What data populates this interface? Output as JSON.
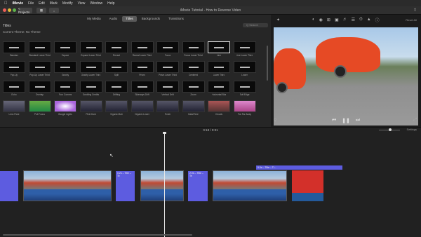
{
  "menubar": {
    "apple": "",
    "items": [
      "iMovie",
      "File",
      "Edit",
      "Mark",
      "Modify",
      "View",
      "Window",
      "Help"
    ]
  },
  "toolbar": {
    "projects_label": "< Projects",
    "window_title": "iMovie Tutorial - How to Reverse Video"
  },
  "browser": {
    "tabs": [
      "My Media",
      "Audio",
      "Titles",
      "Backgrounds",
      "Transitions"
    ],
    "active_tab": "Titles",
    "panel_title": "Titles",
    "theme_label": "Current Theme: No Theme",
    "search_placeholder": "Q Search",
    "titles": [
      "Standard",
      "Standard Lower Third",
      "Expand",
      "Expand Lower Third",
      "Reveal",
      "Reveal Lower Third",
      "Focus",
      "Focus Lower Third",
      "Line",
      "Line Lower Third",
      "Pop-Up",
      "Pop-Up Lower Third",
      "Gravity",
      "Gravity Lower Third",
      "Split",
      "Prism",
      "Prism Lower Third",
      "Centered",
      "Lower Third",
      "Lower",
      "Echo",
      "Overlap",
      "Four Corners",
      "Scrolling Credits",
      "Drifting",
      "Sideways Drift",
      "Vertical Drift",
      "Zoom",
      "Horizontal Blur",
      "Soft Edge",
      "Lens Flare",
      "Pull Focus",
      "Boogie Lights",
      "Pixie Dust",
      "Organic Main",
      "Organic Lower",
      "Ticker",
      "Data/Time",
      "Clouds",
      "Far Far Away"
    ],
    "selected_title": "Line"
  },
  "viewer": {
    "tools": [
      "wand-icon",
      "color-balance-icon",
      "color-icon",
      "crop-icon",
      "stabilize-icon",
      "volume-icon",
      "noise-icon",
      "speed-icon",
      "filter-icon",
      "info-icon"
    ],
    "reset_label": "Reset All"
  },
  "timeline": {
    "timecode": "0:18 / 0:31",
    "settings_label": "Settings",
    "title_clip_label": "5.0s – Title – Ti...",
    "clip_labels": [
      "0.2s – Title – Te",
      "2.0s – Title – Te"
    ]
  },
  "colors": {
    "accent": "#5d5ce0",
    "selection": "#e8e8e8"
  }
}
